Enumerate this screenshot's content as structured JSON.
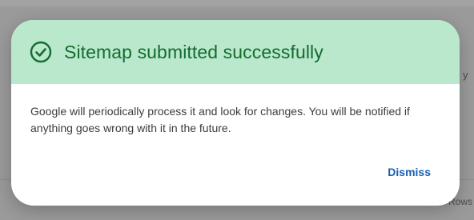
{
  "background": {
    "right_label": "Rows",
    "right_mark": "y"
  },
  "dialog": {
    "title": "Sitemap submitted successfully",
    "message": "Google will periodically process it and look for changes. You will be notified if anything goes wrong with it in the future.",
    "dismiss_label": "Dismiss",
    "icon": "check-circle-icon"
  },
  "colors": {
    "header_bg": "#b9e8cd",
    "title_text": "#146c2e",
    "action_text": "#1a5fb4"
  }
}
